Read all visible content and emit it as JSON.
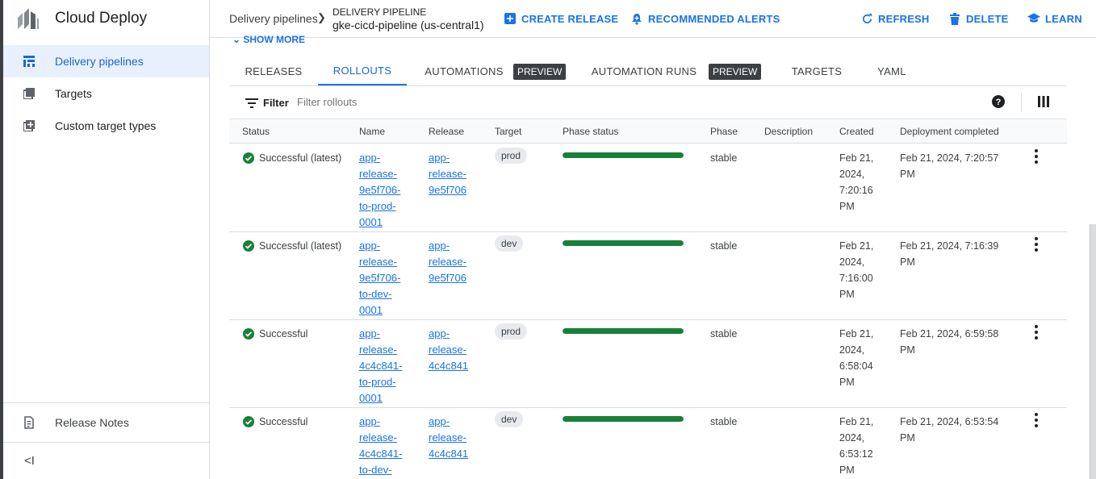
{
  "sidebar": {
    "app_title": "Cloud Deploy",
    "items": [
      {
        "label": "Delivery pipelines",
        "active": true
      },
      {
        "label": "Targets",
        "active": false
      },
      {
        "label": "Custom target types",
        "active": false
      }
    ],
    "release_notes": "Release Notes",
    "collapse_label": "<I"
  },
  "header": {
    "breadcrumb": "Delivery pipelines",
    "pipeline_kicker": "DELIVERY PIPELINE",
    "pipeline_name": "gke-cicd-pipeline (us-central1)",
    "actions": {
      "create_release": "CREATE RELEASE",
      "recommended_alerts": "RECOMMENDED ALERTS",
      "refresh": "REFRESH",
      "delete": "DELETE",
      "learn": "LEARN"
    }
  },
  "show_more": "SHOW MORE",
  "tabs": {
    "releases": "RELEASES",
    "rollouts": "ROLLOUTS",
    "automations": "AUTOMATIONS",
    "automation_runs": "AUTOMATION RUNS",
    "targets": "TARGETS",
    "yaml": "YAML",
    "preview_badge": "PREVIEW"
  },
  "filter": {
    "label": "Filter",
    "placeholder": "Filter rollouts"
  },
  "columns": {
    "status": "Status",
    "name": "Name",
    "release": "Release",
    "target": "Target",
    "phase_status": "Phase status",
    "phase": "Phase",
    "description": "Description",
    "created": "Created",
    "deployment_completed": "Deployment completed"
  },
  "rows": [
    {
      "status": "Successful (latest)",
      "name_lines": [
        "app-",
        "release-",
        "9e5f706-",
        "to-prod-",
        "0001"
      ],
      "release_lines": [
        "app-",
        "release-",
        "9e5f706"
      ],
      "target": "prod",
      "phase_progress": 1.0,
      "phase": "stable",
      "description": "",
      "created_lines": [
        "Feb 21,",
        "2024,",
        "7:20:16",
        "PM"
      ],
      "completed_lines": [
        "Feb 21, 2024, 7:20:57",
        "PM"
      ]
    },
    {
      "status": "Successful (latest)",
      "name_lines": [
        "app-",
        "release-",
        "9e5f706-",
        "to-dev-",
        "0001"
      ],
      "release_lines": [
        "app-",
        "release-",
        "9e5f706"
      ],
      "target": "dev",
      "phase_progress": 1.0,
      "phase": "stable",
      "description": "",
      "created_lines": [
        "Feb 21,",
        "2024,",
        "7:16:00",
        "PM"
      ],
      "completed_lines": [
        "Feb 21, 2024, 7:16:39",
        "PM"
      ]
    },
    {
      "status": "Successful",
      "name_lines": [
        "app-",
        "release-",
        "4c4c841-",
        "to-prod-",
        "0001"
      ],
      "release_lines": [
        "app-",
        "release-",
        "4c4c841"
      ],
      "target": "prod",
      "phase_progress": 1.0,
      "phase": "stable",
      "description": "",
      "created_lines": [
        "Feb 21,",
        "2024,",
        "6:58:04",
        "PM"
      ],
      "completed_lines": [
        "Feb 21, 2024, 6:59:58",
        "PM"
      ]
    },
    {
      "status": "Successful",
      "name_lines": [
        "app-",
        "release-",
        "4c4c841-",
        "to-dev-"
      ],
      "release_lines": [
        "app-",
        "release-",
        "4c4c841"
      ],
      "target": "dev",
      "phase_progress": 1.0,
      "phase": "stable",
      "description": "",
      "created_lines": [
        "Feb 21,",
        "2024,",
        "6:53:12",
        "PM"
      ],
      "completed_lines": [
        "Feb 21, 2024, 6:53:54",
        "PM"
      ]
    }
  ],
  "colors": {
    "accent": "#1a73e8",
    "success": "#188038",
    "preview_badge_bg": "#3c4043"
  }
}
